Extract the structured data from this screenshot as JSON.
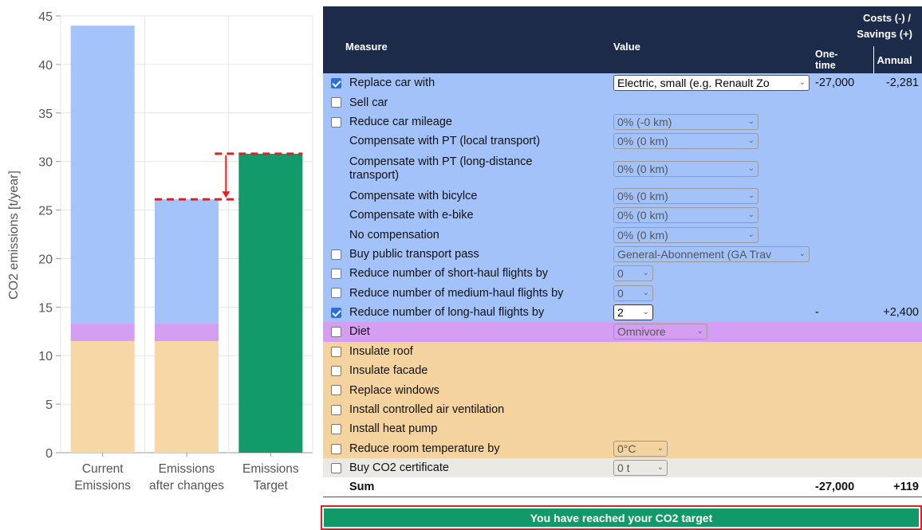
{
  "chart_data": {
    "type": "bar",
    "stacked": true,
    "ylabel": "CO2 emissions [t/year]",
    "ylim": [
      0,
      45
    ],
    "yticks": [
      0,
      5,
      10,
      15,
      20,
      25,
      30,
      35,
      40,
      45
    ],
    "grid": true,
    "categories": [
      [
        "Current",
        "Emissions"
      ],
      [
        "Emissions",
        "after changes"
      ],
      [
        "Emissions",
        "Target"
      ]
    ],
    "series": [
      {
        "color": "#f7d7a5",
        "values": [
          11.5,
          11.5,
          0
        ]
      },
      {
        "color": "#d49ef2",
        "values": [
          1.8,
          1.8,
          0
        ]
      },
      {
        "color": "#a5c3fb",
        "values": [
          30.7,
          12.8,
          0
        ]
      },
      {
        "color": "#129a6b",
        "values": [
          0,
          0,
          30.8
        ]
      }
    ],
    "annotation": {
      "from": 30.8,
      "to": 26.1,
      "color": "#e0201d"
    }
  },
  "table": {
    "header": {
      "measure": "Measure",
      "value": "Value",
      "costs_line1": "Costs (-) /",
      "costs_line2": "Savings (+)",
      "onetime_line1": "One-",
      "onetime_line2": "time",
      "annual": "Annual"
    },
    "rows": [
      {
        "cat": "car",
        "checkbox": true,
        "checked": true,
        "label": "Replace car with",
        "select": "Electric, small (e.g. Renault Zo",
        "select_style": "wide",
        "onetime": "-27,000",
        "annual": "-2,281"
      },
      {
        "cat": "car",
        "checkbox": true,
        "checked": false,
        "label": "Sell car",
        "select": "",
        "onetime": "",
        "annual": ""
      },
      {
        "cat": "car",
        "checkbox": true,
        "checked": false,
        "label": "Reduce car mileage",
        "select": "0% (-0 km)",
        "select_style": "med",
        "onetime": "",
        "annual": ""
      },
      {
        "cat": "car",
        "checkbox": false,
        "checked": false,
        "label": "Compensate with PT (local transport)",
        "select": "0% (0 km)",
        "select_style": "med",
        "onetime": "",
        "annual": ""
      },
      {
        "cat": "car",
        "checkbox": false,
        "checked": false,
        "label": "Compensate with PT (long-distance transport)",
        "select": "0% (0 km)",
        "select_style": "med",
        "tall": true,
        "onetime": "",
        "annual": ""
      },
      {
        "cat": "car",
        "checkbox": false,
        "checked": false,
        "label": "Compensate with bicylce",
        "select": "0% (0 km)",
        "select_style": "med",
        "onetime": "",
        "annual": ""
      },
      {
        "cat": "car",
        "checkbox": false,
        "checked": false,
        "label": "Compensate with e-bike",
        "select": "0% (0 km)",
        "select_style": "med",
        "onetime": "",
        "annual": ""
      },
      {
        "cat": "car",
        "checkbox": false,
        "checked": false,
        "label": "No compensation",
        "select": "0% (0 km)",
        "select_style": "med",
        "onetime": "",
        "annual": ""
      },
      {
        "cat": "car",
        "checkbox": true,
        "checked": false,
        "label": "Buy public transport pass",
        "select": "General-Abonnement (GA Trav",
        "select_style": "wide2",
        "onetime": "",
        "annual": ""
      },
      {
        "cat": "car",
        "checkbox": true,
        "checked": false,
        "label": "Reduce number of short-haul flights by",
        "select": "0",
        "select_style": "tiny",
        "onetime": "",
        "annual": ""
      },
      {
        "cat": "car",
        "checkbox": true,
        "checked": false,
        "label": "Reduce number of medium-haul flights by",
        "select": "0",
        "select_style": "tiny",
        "onetime": "",
        "annual": ""
      },
      {
        "cat": "car",
        "checkbox": true,
        "checked": true,
        "label": "Reduce number of long-haul flights by",
        "select": "2",
        "select_style": "tiny-active",
        "onetime": "-",
        "annual": "+2,400"
      },
      {
        "cat": "diet",
        "checkbox": true,
        "checked": false,
        "label": "Diet",
        "select": "Omnivore",
        "select_style": "diet",
        "onetime": "",
        "annual": ""
      },
      {
        "cat": "house",
        "checkbox": true,
        "checked": false,
        "label": "Insulate roof",
        "select": "",
        "onetime": "",
        "annual": ""
      },
      {
        "cat": "house",
        "checkbox": true,
        "checked": false,
        "label": "Insulate facade",
        "select": "",
        "onetime": "",
        "annual": ""
      },
      {
        "cat": "house",
        "checkbox": true,
        "checked": false,
        "label": "Replace windows",
        "select": "",
        "onetime": "",
        "annual": ""
      },
      {
        "cat": "house",
        "checkbox": true,
        "checked": false,
        "label": "Install controlled air ventilation",
        "select": "",
        "onetime": "",
        "annual": ""
      },
      {
        "cat": "house",
        "checkbox": true,
        "checked": false,
        "label": "Install heat pump",
        "select": "",
        "onetime": "",
        "annual": ""
      },
      {
        "cat": "house",
        "checkbox": true,
        "checked": false,
        "label": "Reduce room temperature by",
        "select": "0°C",
        "select_style": "small",
        "onetime": "",
        "annual": ""
      },
      {
        "cat": "cert",
        "checkbox": true,
        "checked": false,
        "label": "Buy CO2 certificate",
        "select": "0 t",
        "select_style": "small",
        "onetime": "",
        "annual": ""
      }
    ],
    "sum": {
      "label": "Sum",
      "onetime": "-27,000",
      "annual": "+119"
    }
  },
  "target_message": "You have reached your CO2 target",
  "icons": {
    "checkbox": "checkbox-icon",
    "dropdown": "chevron-down-icon"
  }
}
